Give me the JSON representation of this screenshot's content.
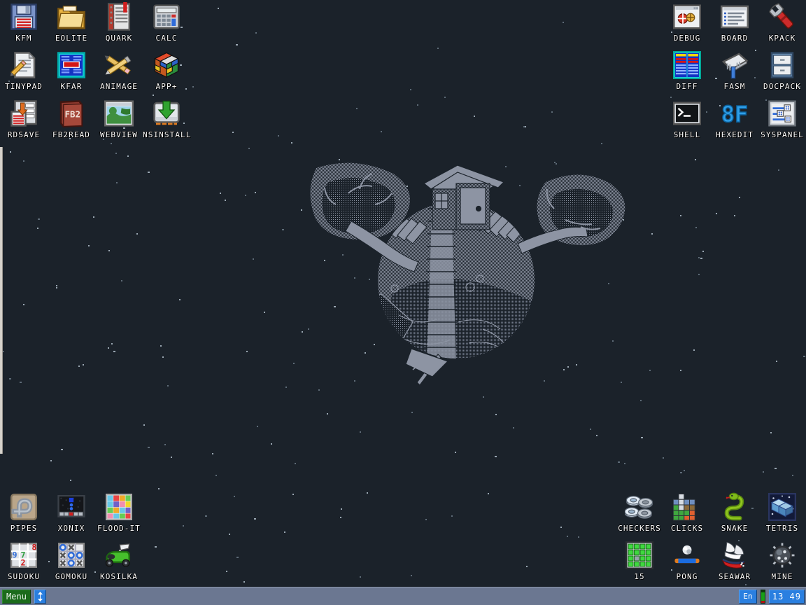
{
  "desktop": {
    "background_color": "#1b222a",
    "star_color": "#9aa7b2",
    "wallpaper_name": "tiny-planet-treehouse",
    "wallpaper_fill": "#8d94a3"
  },
  "icons": {
    "top_left": [
      {
        "label": "KFM",
        "icon": "floppy-disk-icon"
      },
      {
        "label": "EOLITE",
        "icon": "folder-icon"
      },
      {
        "label": "QUARK",
        "icon": "notebook-icon"
      },
      {
        "label": "CALC",
        "icon": "calculator-icon"
      },
      {
        "label": "TINYPAD",
        "icon": "document-pencil-icon"
      },
      {
        "label": "KFAR",
        "icon": "blue-filemanager-icon"
      },
      {
        "label": "ANIMAGE",
        "icon": "pencil-brush-cross-icon"
      },
      {
        "label": "APP+",
        "icon": "rubiks-cube-icon"
      },
      {
        "label": "RDSAVE",
        "icon": "ramdisk-save-icon"
      },
      {
        "label": "FB2READ",
        "icon": "fb2-book-icon"
      },
      {
        "label": "WEBVIEW",
        "icon": "globe-window-icon"
      },
      {
        "label": "NSINSTALL",
        "icon": "install-arrow-icon"
      }
    ],
    "top_right": [
      {
        "label": "DEBUG",
        "icon": "debug-bug-window-icon"
      },
      {
        "label": "BOARD",
        "icon": "board-text-window-icon"
      },
      {
        "label": "KPACK",
        "icon": "red-wrench-icon"
      },
      {
        "label": "DIFF",
        "icon": "two-blue-tables-icon"
      },
      {
        "label": "FASM",
        "icon": "fasm-anvil-icon"
      },
      {
        "label": "DOCPACK",
        "icon": "filing-cabinet-icon"
      },
      {
        "label": "SHELL",
        "icon": "terminal-prompt-icon"
      },
      {
        "label": "HEXEDIT",
        "icon": "hex-8f-icon"
      },
      {
        "label": "SYSPANEL",
        "icon": "sliders-panel-icon"
      }
    ],
    "bottom_left": [
      {
        "label": "PIPES",
        "icon": "pipes-icon"
      },
      {
        "label": "XONIX",
        "icon": "xonix-icon"
      },
      {
        "label": "FLOOD-IT",
        "icon": "flood-it-grid-icon"
      },
      {
        "label": "SUDOKU",
        "icon": "sudoku-grid-icon"
      },
      {
        "label": "GOMOKU",
        "icon": "tic-tac-toe-icon"
      },
      {
        "label": "KOSILKA",
        "icon": "lawnmower-icon"
      }
    ],
    "bottom_right": [
      {
        "label": "CHECKERS",
        "icon": "checkers-pieces-icon"
      },
      {
        "label": "CLICKS",
        "icon": "colored-blocks-icon"
      },
      {
        "label": "SNAKE",
        "icon": "green-snake-icon"
      },
      {
        "label": "TETRIS",
        "icon": "tetris-block-icon"
      },
      {
        "label": "15",
        "icon": "fifteen-puzzle-icon"
      },
      {
        "label": "PONG",
        "icon": "pong-paddle-ball-icon"
      },
      {
        "label": "SEAWAR",
        "icon": "sailing-ship-icon"
      },
      {
        "label": "MINE",
        "icon": "sea-mine-icon"
      }
    ]
  },
  "taskbar": {
    "menu_label": "Menu",
    "minimize_icon": "up-down-arrows-icon",
    "lang_label": "En",
    "cpu_meter_icon": "cpu-load-meter",
    "clock_value": "13 49",
    "background_color": "#6b7791",
    "menu_color": "#1b6b1b",
    "button_color": "#2a7fe0"
  }
}
